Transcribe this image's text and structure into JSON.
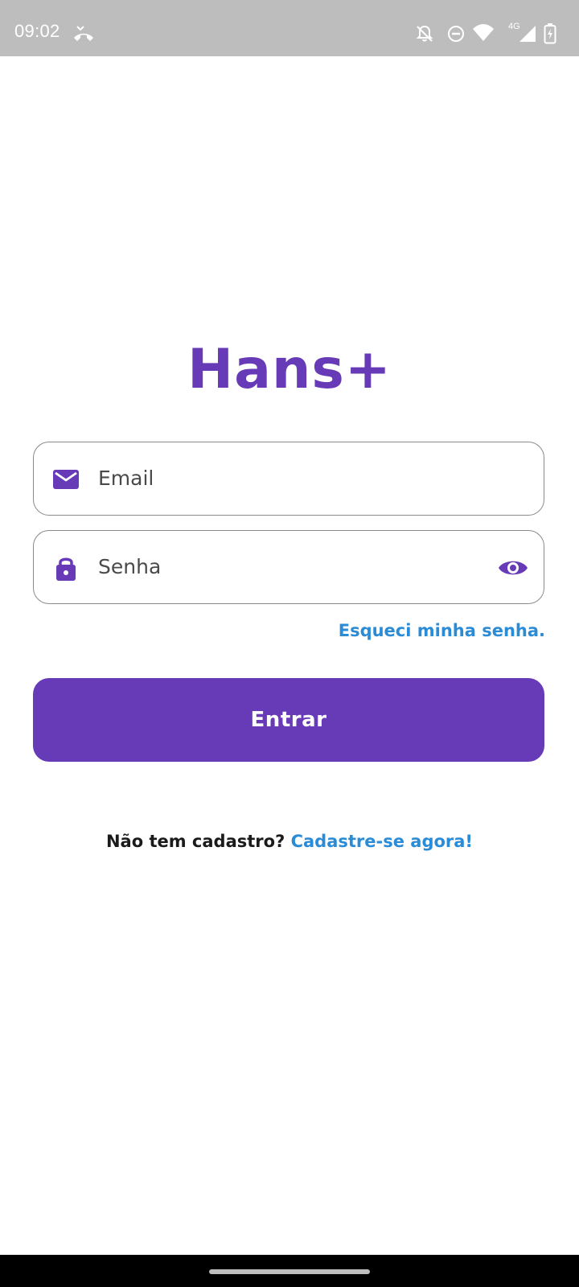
{
  "status_bar": {
    "time": "09:02",
    "network_label": "4G",
    "icons": [
      "missed-call-icon",
      "bell-off-icon",
      "do-not-disturb-icon",
      "wifi-icon",
      "cell-signal-icon",
      "battery-charging-icon"
    ]
  },
  "app": {
    "title": "Hans+"
  },
  "form": {
    "email": {
      "placeholder": "Email",
      "value": "",
      "icon": "mail-icon"
    },
    "password": {
      "placeholder": "Senha",
      "value": "",
      "icon": "lock-icon",
      "toggle_icon": "eye-icon"
    },
    "forgot_password": "Esqueci minha senha.",
    "submit_label": "Entrar"
  },
  "signup": {
    "prompt": "Não tem cadastro?",
    "link": "Cadastre-se agora!"
  },
  "colors": {
    "primary": "#673ab7",
    "link": "#2a8bd6",
    "status_bar": "#bdbdbd",
    "nav_bar": "#000000"
  }
}
